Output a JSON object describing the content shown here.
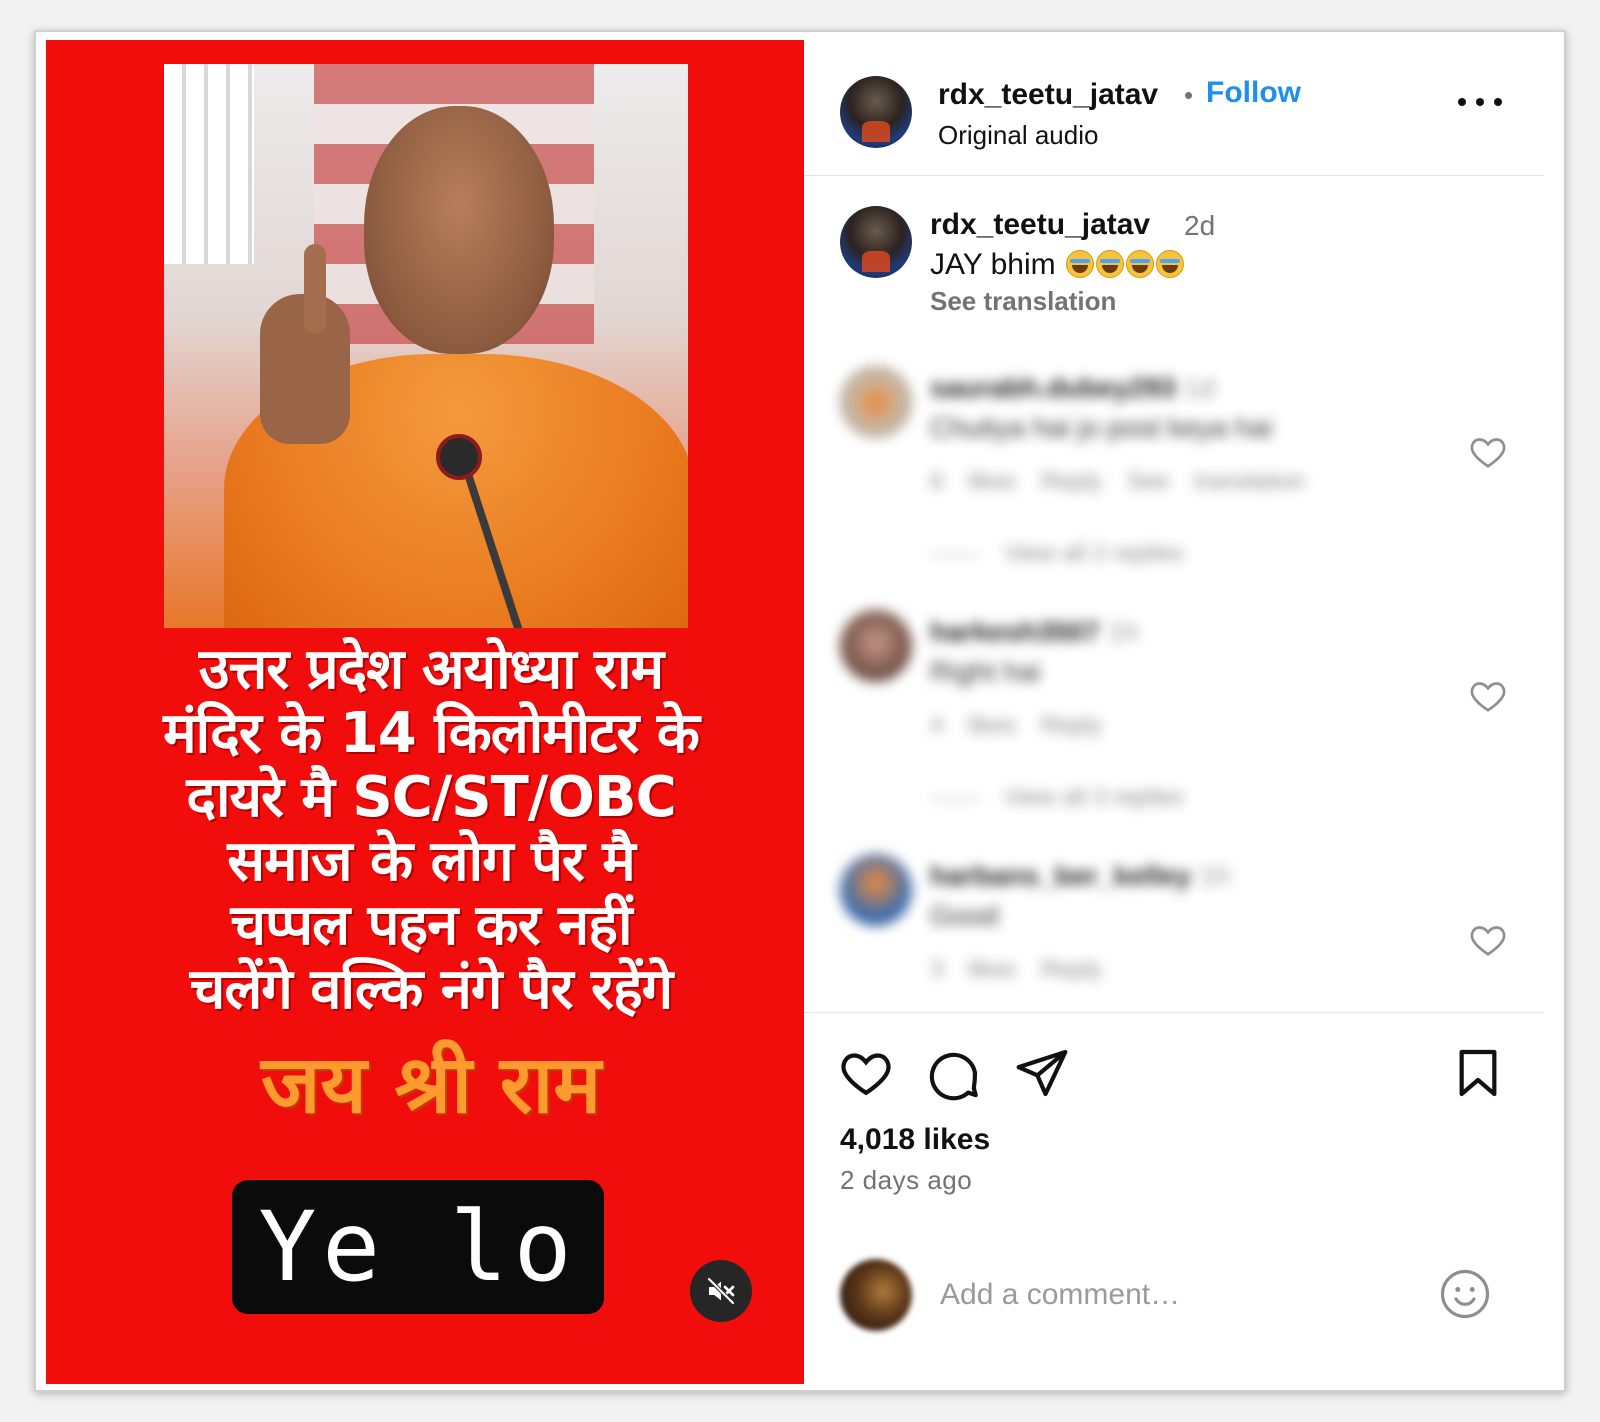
{
  "media": {
    "headline_lines": [
      "उत्तर प्रदेश अयोध्या राम",
      "मंदिर के 14 किलोमीटर के",
      "दायरे मै SC/ST/OBC",
      "समाज के लोग पैर मै",
      "चप्पल पहन कर नहीं",
      "चलेंगे वल्कि नंगे पैर रहेंगे"
    ],
    "headline_accent": "जय श्री राम",
    "overlay_caption": "Ye lo",
    "mute_icon": "speaker-muted-icon"
  },
  "header": {
    "username": "rdx_teetu_jatav",
    "separator": "•",
    "follow_label": "Follow",
    "audio_label": "Original audio",
    "more_icon": "more-horizontal-icon"
  },
  "caption": {
    "username": "rdx_teetu_jatav",
    "time": "2d",
    "text": "JAY bhim",
    "emoji_count": 4,
    "see_translation": "See translation"
  },
  "comments": [
    {
      "username": "saurabh.dubey293",
      "time": "1d",
      "text": "Chutiya hai jo post keya hai",
      "likes": "6 likes",
      "reply": "Reply",
      "translation": "See translation",
      "view_replies": "View all 2 replies"
    },
    {
      "username": "harkesh3507",
      "time": "1h",
      "text": "Right hai",
      "likes": "4 likes",
      "reply": "Reply",
      "view_replies": "View all 3 replies"
    },
    {
      "username": "harbans_ber_kelley",
      "time": "1h",
      "text": "Good",
      "likes": "3 likes",
      "reply": "Reply"
    }
  ],
  "actions": {
    "like_icon": "heart-icon",
    "comment_icon": "comment-icon",
    "share_icon": "send-icon",
    "save_icon": "bookmark-icon",
    "likes": "4,018 likes",
    "time_ago": "2 days ago"
  },
  "add_comment": {
    "placeholder": "Add a comment…",
    "emoji_icon": "smiley-icon"
  },
  "colors": {
    "accent": "#1f8ef1",
    "media_background": "#f20d0d",
    "headline_accent": "#ff9a2e"
  }
}
